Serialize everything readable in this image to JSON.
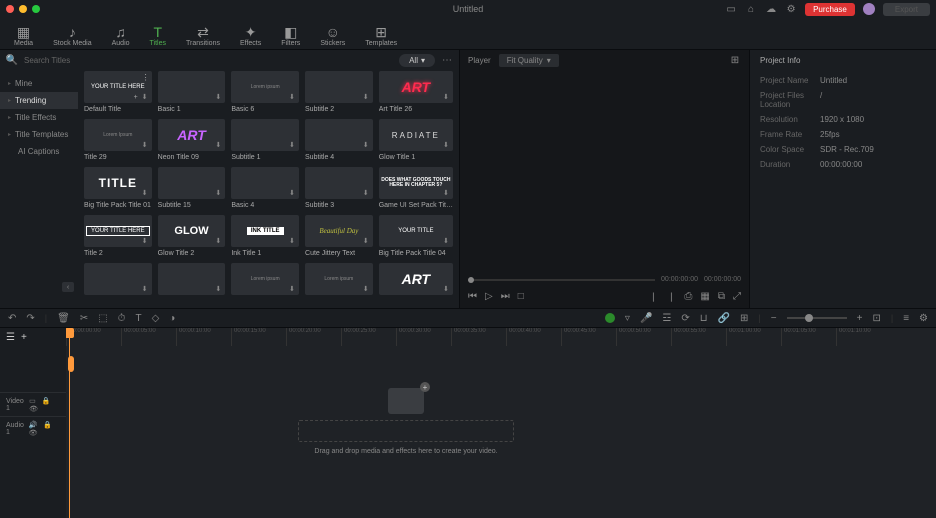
{
  "window": {
    "title": "Untitled",
    "purchase": "Purchase",
    "export": "Export"
  },
  "tabs": [
    {
      "label": "Media",
      "glyph": "▦"
    },
    {
      "label": "Stock Media",
      "glyph": "♪"
    },
    {
      "label": "Audio",
      "glyph": "♫"
    },
    {
      "label": "Titles",
      "glyph": "T",
      "active": true
    },
    {
      "label": "Transitions",
      "glyph": "⇄"
    },
    {
      "label": "Effects",
      "glyph": "✦"
    },
    {
      "label": "Filters",
      "glyph": "◧"
    },
    {
      "label": "Stickers",
      "glyph": "☺"
    },
    {
      "label": "Templates",
      "glyph": "⊞"
    }
  ],
  "sidebar": [
    {
      "label": "Mine"
    },
    {
      "label": "Trending",
      "sel": true
    },
    {
      "label": "Title Effects"
    },
    {
      "label": "Title Templates"
    },
    {
      "label": "AI Captions",
      "noexp": true
    }
  ],
  "search": {
    "placeholder": "Search Titles",
    "filter": "All"
  },
  "titles": [
    {
      "label": "Default Title",
      "render": "YOUR TITLE HERE",
      "cls": "",
      "menu": true,
      "plus": true
    },
    {
      "label": "Basic 1",
      "render": "",
      "cls": ""
    },
    {
      "label": "Basic 6",
      "render": "Lorem ipsum",
      "cls": "tiny"
    },
    {
      "label": "Subtitle 2",
      "render": "",
      "cls": "tiny"
    },
    {
      "label": "Art Title 26",
      "render": "ART",
      "cls": "art-red"
    },
    {
      "label": "Title 29",
      "render": "Lorem Ipsum",
      "cls": "tiny"
    },
    {
      "label": "Neon Title 09",
      "render": "ART",
      "cls": "art-pink"
    },
    {
      "label": "Subtitle 1",
      "render": "",
      "cls": "tiny"
    },
    {
      "label": "Subtitle 4",
      "render": "",
      "cls": "tiny"
    },
    {
      "label": "Glow Title 1",
      "render": "RADIATE",
      "cls": "radiate"
    },
    {
      "label": "Big Title Pack Title 01",
      "render": "TITLE",
      "cls": "title-big"
    },
    {
      "label": "Subtitle 15",
      "render": "",
      "cls": "tiny"
    },
    {
      "label": "Basic 4",
      "render": "",
      "cls": "tiny"
    },
    {
      "label": "Subtitle 3",
      "render": "",
      "cls": "tiny"
    },
    {
      "label": "Game UI Set Pack Tit…",
      "render": "DOES WHAT GOODS TOUCH HERE IN CHAPTER 5?",
      "cls": "gameui"
    },
    {
      "label": "Title 2",
      "render": "YOUR TITLE HERE",
      "cls": "outline"
    },
    {
      "label": "Glow Title 2",
      "render": "GLOW",
      "cls": "glow"
    },
    {
      "label": "Ink Title 1",
      "render": "INK TITLE",
      "cls": "inkbg"
    },
    {
      "label": "Cute Jittery Text",
      "render": "Beautiful Day",
      "cls": "bday"
    },
    {
      "label": "Big Title Pack Title 04",
      "render": "YOUR TITLE",
      "cls": ""
    },
    {
      "label": "",
      "render": "",
      "cls": ""
    },
    {
      "label": "",
      "render": "",
      "cls": ""
    },
    {
      "label": "",
      "render": "Lorem ipsum",
      "cls": "tiny"
    },
    {
      "label": "",
      "render": "Lorem ipsum",
      "cls": "tiny"
    },
    {
      "label": "",
      "render": "ART",
      "cls": "art"
    }
  ],
  "preview": {
    "tab": "Player",
    "quality": "Fit Quality",
    "time_cur": "00:00:00:00",
    "time_dur": "00:00:00:00"
  },
  "info": {
    "heading": "Project Info",
    "rows": [
      {
        "k": "Project Name",
        "v": "Untitled"
      },
      {
        "k": "Project Files Location",
        "v": "/"
      },
      {
        "k": "Resolution",
        "v": "1920 x 1080"
      },
      {
        "k": "Frame Rate",
        "v": "25fps"
      },
      {
        "k": "Color Space",
        "v": "SDR - Rec.709"
      },
      {
        "k": "Duration",
        "v": "00:00:00:00"
      }
    ]
  },
  "ruler": [
    "00:00:00:00",
    "00:00:05:00",
    "00:00:10:00",
    "00:00:15:00",
    "00:00:20:00",
    "00:00:25:00",
    "00:00:30:00",
    "00:00:35:00",
    "00:00:40:00",
    "00:00:45:00",
    "00:00:50:00",
    "00:00:55:00",
    "00:01:00:00",
    "00:01:05:00",
    "00:01:10:00"
  ],
  "tracks": [
    {
      "name": "Video 1",
      "icons": "▭ 🔒 👁"
    },
    {
      "name": "Audio 1",
      "icons": "🔊 🔒 👁"
    }
  ],
  "dropzone_hint": "Drag and drop media and effects here to create your video."
}
